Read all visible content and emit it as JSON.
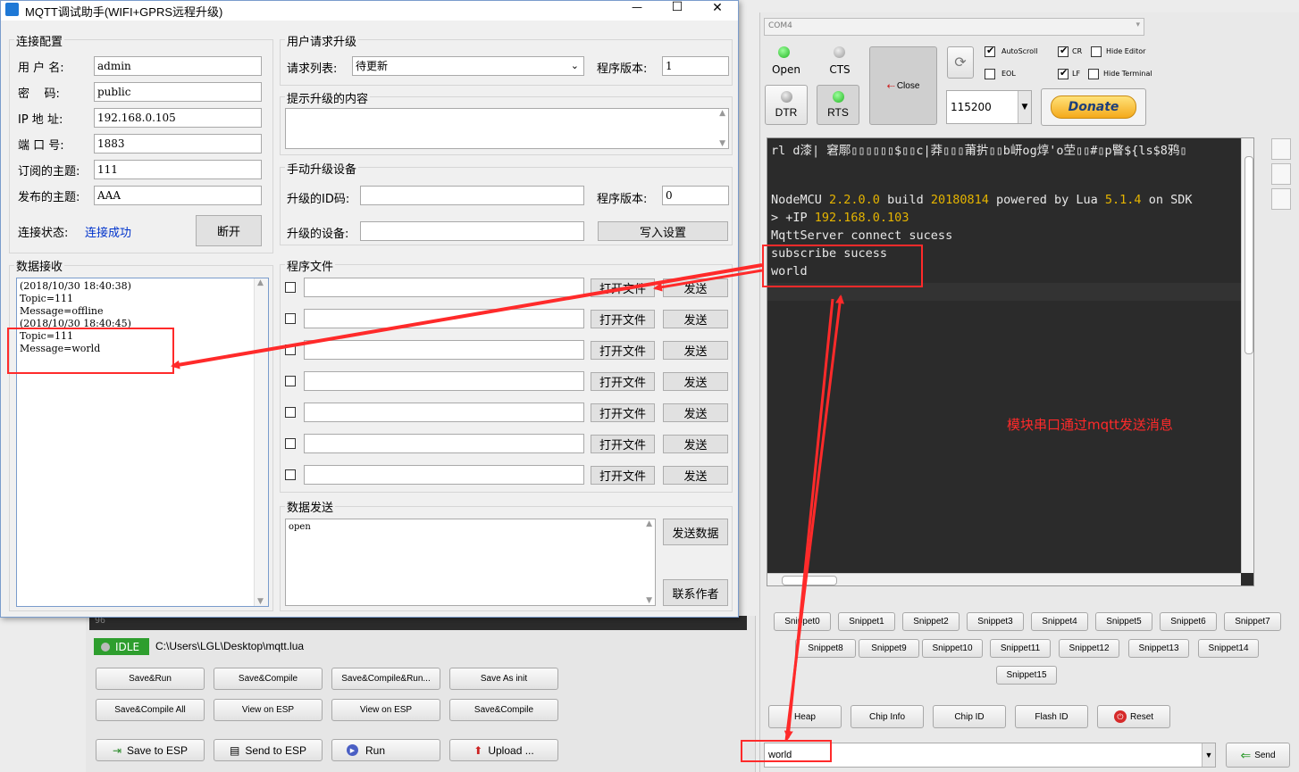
{
  "mqtt_window": {
    "title": "MQTT调试助手(WIFI+GPRS远程升级)",
    "controls": {
      "minimize": "—",
      "maximize": "☐",
      "close": "✕"
    },
    "conn": {
      "group_title": "连接配置",
      "username_label": "用 户 名:",
      "username": "admin",
      "password_label": "密    码:",
      "password": "public",
      "ip_label": "IP 地 址:",
      "ip": "192.168.0.105",
      "port_label": "端 口 号:",
      "port": "1883",
      "sub_label": "订阅的主题:",
      "sub_topic": "111",
      "pub_label": "发布的主题:",
      "pub_topic": "AAA",
      "status_label": "连接状态:",
      "status": "连接成功",
      "disconnect": "断开"
    },
    "recv": {
      "group_title": "数据接收",
      "lines": [
        "(2018/10/30 18:40:38)",
        "Topic=111",
        "Message=offline",
        "(2018/10/30 18:40:45)",
        "Topic=111",
        "Message=world"
      ]
    },
    "upgrade": {
      "group_title": "用户请求升级",
      "list_label": "请求列表:",
      "list_value": "待更新",
      "version_label": "程序版本:",
      "version_value": "1"
    },
    "hint": {
      "group_title": "提示升级的内容"
    },
    "manual": {
      "group_title": "手动升级设备",
      "id_label": "升级的ID码:",
      "version_label": "程序版本:",
      "version_value": "0",
      "device_label": "升级的设备:",
      "write_button": "写入设置"
    },
    "files": {
      "group_title": "程序文件",
      "open_label": "打开文件",
      "send_label": "发送",
      "rows": [
        "",
        "",
        "",
        "",
        "",
        "",
        ""
      ]
    },
    "send": {
      "group_title": "数据发送",
      "text": "open",
      "send_button": "发送数据",
      "contact_button": "联系作者"
    }
  },
  "esplorer": {
    "port": "COM4",
    "open": "Open",
    "cts": "CTS",
    "dtr": "DTR",
    "rts": "RTS",
    "close": "Close",
    "autoscroll": "AutoScroll",
    "cr": "CR",
    "hide_editor": "Hide Editor",
    "eol": "EOL",
    "lf": "LF",
    "hide_terminal": "Hide Terminal",
    "baud": "115200",
    "donate": "Donate",
    "terminal": {
      "garbage": "rl d漆| 窘鄏▯▯▯▯▯▯$▯▯c|莽▯▯▯莆扸▯▯b岍og焞'o茔▯▯#▯p睯${ls$8鸦▯",
      "line2_a": "NodeMCU ",
      "line2_b": "2.2.0.0",
      "line2_c": " build ",
      "line2_d": "20180814",
      "line2_e": " powered by Lua ",
      "line2_f": "5.1.4",
      "line2_g": " on SDK",
      "line3_a": "> +IP ",
      "line3_b": "192.168.0.103",
      "line4": "MqttServer connect sucess",
      "line5": "subscribe sucess",
      "line6": "world"
    },
    "annotation": "模块串口通过mqtt发送消息",
    "snippets": [
      "Snippet0",
      "Snippet1",
      "Snippet2",
      "Snippet3",
      "Snippet4",
      "Snippet5",
      "Snippet6",
      "Snippet7",
      "Snippet8",
      "Snippet9",
      "Snippet10",
      "Snippet11",
      "Snippet12",
      "Snippet13",
      "Snippet14",
      "Snippet15"
    ],
    "heap": "Heap",
    "chip_info": "Chip Info",
    "chip_id": "Chip ID",
    "flash_id": "Flash ID",
    "reset": "Reset",
    "cmd_value": "world",
    "send": "Send"
  },
  "editor": {
    "line_no": "96",
    "status": "IDLE",
    "path": "C:\\Users\\LGL\\Desktop\\mqtt.lua",
    "buttons_row1": [
      "Save&Run",
      "Save&Compile",
      "Save&Compile&Run...",
      "Save As init"
    ],
    "buttons_row2": [
      "Save&Compile All",
      "View on ESP",
      "View on ESP",
      "Save&Compile"
    ],
    "save_to_esp": "Save to ESP",
    "send_to_esp": "Send to ESP",
    "run": "Run",
    "upload": "Upload ..."
  },
  "colors": {
    "annotation": "#ff2a2a",
    "terminal_bg": "#2b2b2b",
    "link": "#0033cc",
    "idle_green": "#2e9e2e"
  }
}
